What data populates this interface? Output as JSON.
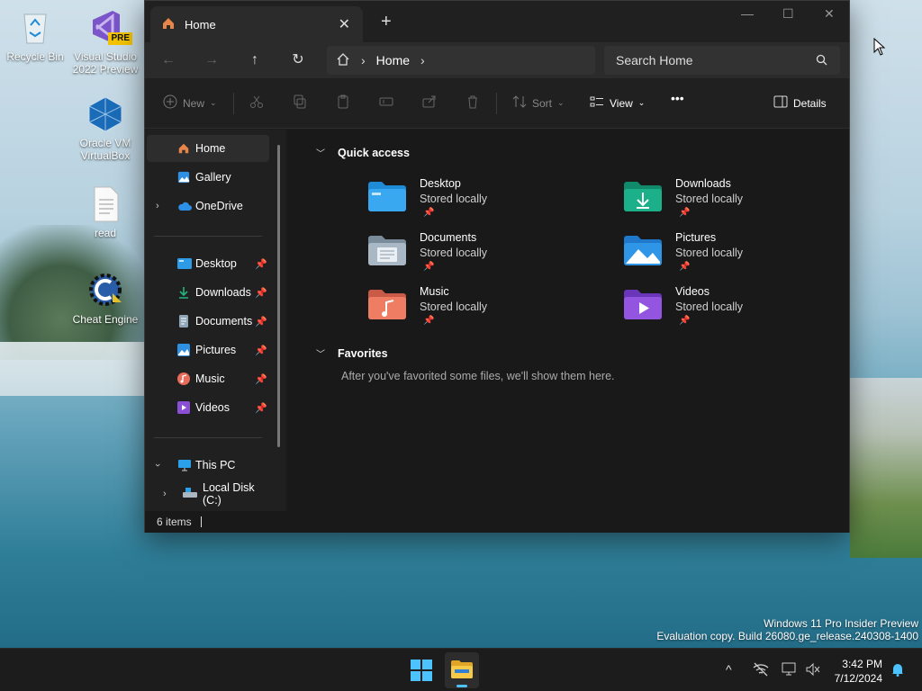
{
  "desktop": {
    "icons": [
      {
        "label": "Recycle Bin"
      },
      {
        "label": "Visual Studio 2022 Preview",
        "badge": "PRE"
      },
      {
        "label": "Oracle VM VirtualBox"
      },
      {
        "label": "read"
      },
      {
        "label": "Cheat Engine"
      }
    ]
  },
  "window": {
    "tab_title": "Home",
    "tab_close": "✕",
    "new_tab": "+",
    "controls": {
      "minimize": "—",
      "maximize": "☐",
      "close": "✕"
    },
    "nav": {
      "back": "←",
      "forward": "→",
      "up": "↑",
      "refresh": "↻"
    },
    "address": {
      "crumb": "Home",
      "sep": "›"
    },
    "search": {
      "placeholder": "Search Home"
    },
    "toolbar": {
      "new": "New",
      "sort": "Sort",
      "view": "View",
      "more": "•••",
      "details": "Details"
    },
    "sidebar": {
      "items": [
        {
          "label": "Home"
        },
        {
          "label": "Gallery"
        },
        {
          "label": "OneDrive"
        },
        {
          "label": "Desktop"
        },
        {
          "label": "Downloads"
        },
        {
          "label": "Documents"
        },
        {
          "label": "Pictures"
        },
        {
          "label": "Music"
        },
        {
          "label": "Videos"
        },
        {
          "label": "This PC"
        },
        {
          "label": "Local Disk (C:)"
        }
      ]
    },
    "content": {
      "quick_access_title": "Quick access",
      "favorites_title": "Favorites",
      "favorites_empty": "After you've favorited some files, we'll show them here.",
      "folders": [
        {
          "name": "Desktop",
          "status": "Stored locally"
        },
        {
          "name": "Downloads",
          "status": "Stored locally"
        },
        {
          "name": "Documents",
          "status": "Stored locally"
        },
        {
          "name": "Pictures",
          "status": "Stored locally"
        },
        {
          "name": "Music",
          "status": "Stored locally"
        },
        {
          "name": "Videos",
          "status": "Stored locally"
        }
      ]
    },
    "status": {
      "items": "6 items"
    }
  },
  "watermark": {
    "line1": "Windows 11 Pro Insider Preview",
    "line2": "Evaluation copy. Build 26080.ge_release.240308-1400"
  },
  "taskbar": {
    "time": "3:42 PM",
    "date": "7/12/2024",
    "chevron": "^"
  },
  "colors": {
    "accent": "#4cc2ff",
    "window_bg": "#1c1c1c",
    "taskbar_bg": "#1c1c1c"
  }
}
